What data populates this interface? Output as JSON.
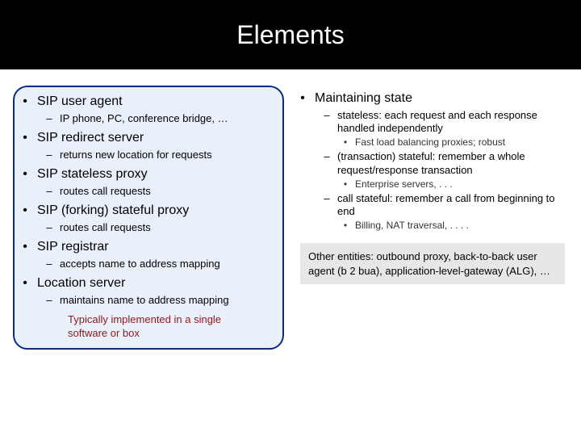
{
  "title": "Elements",
  "left": {
    "items": [
      {
        "label": "SIP user agent",
        "sub": [
          {
            "label": "IP phone, PC, conference bridge, …"
          }
        ]
      },
      {
        "label": "SIP redirect server",
        "sub": [
          {
            "label": "returns new location for requests"
          }
        ]
      },
      {
        "label": "SIP stateless proxy",
        "sub": [
          {
            "label": "routes call requests"
          }
        ]
      },
      {
        "label": "SIP (forking) stateful proxy",
        "sub": [
          {
            "label": "routes call requests"
          }
        ]
      },
      {
        "label": "SIP registrar",
        "sub": [
          {
            "label": "accepts name to address mapping"
          }
        ]
      },
      {
        "label": "Location server",
        "sub": [
          {
            "label": "maintains name to address mapping"
          }
        ]
      }
    ],
    "note": "Typically implemented in a single software or box"
  },
  "right": {
    "heading": "Maintaining state",
    "items": [
      {
        "label": "stateless: each request and each response handled independently",
        "sub": [
          {
            "label": "Fast load balancing proxies; robust"
          }
        ]
      },
      {
        "label": "(transaction) stateful: remember a whole request/response transaction",
        "sub": [
          {
            "label": "Enterprise servers, . . ."
          }
        ]
      },
      {
        "label": "call stateful: remember a call from beginning to end",
        "sub": [
          {
            "label": "Billing, NAT traversal, . . . ."
          }
        ]
      }
    ],
    "other": "Other entities: outbound proxy, back-to-back user agent (b 2 bua), application-level-gateway (ALG), …"
  }
}
